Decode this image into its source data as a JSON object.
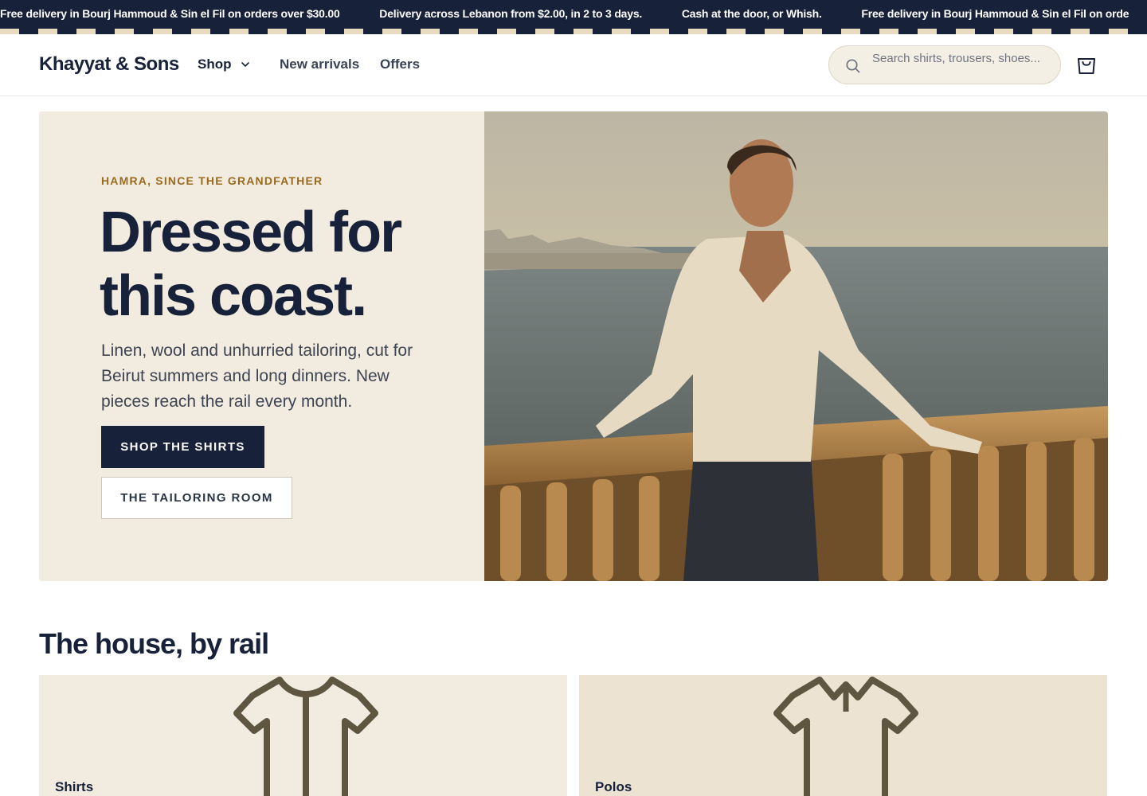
{
  "announcement": {
    "messages": [
      "Free delivery in Bourj Hammoud & Sin el Fil on orders over $30.00",
      "Delivery across Lebanon from $2.00, in 2 to 3 days.",
      "Cash at the door, or Whish.",
      "Free delivery in Bourj Hammoud & Sin el Fil on orde"
    ]
  },
  "header": {
    "logo": "Khayyat & Sons",
    "nav": {
      "shop": "Shop",
      "new_arrivals": "New arrivals",
      "offers": "Offers"
    },
    "search": {
      "placeholder": "Search shirts, trousers, shoes..."
    }
  },
  "hero": {
    "eyebrow": "HAMRA, SINCE THE GRANDFATHER",
    "title": "Dressed for this coast.",
    "subtitle": "Linen, wool and unhurried tailoring, cut for Beirut summers and long dinners. New pieces reach the rail every month.",
    "primary_cta": "SHOP THE SHIRTS",
    "secondary_cta": "THE TAILORING ROOM"
  },
  "section": {
    "title": "The house, by rail",
    "categories": [
      {
        "label": "Shirts",
        "icon": "shirt-icon"
      },
      {
        "label": "Polos",
        "icon": "polo-icon"
      }
    ]
  },
  "colors": {
    "navy": "#17223a",
    "cream": "#f2ebdf",
    "gold": "#9a6a1e",
    "icon_brown": "#5e5640"
  }
}
